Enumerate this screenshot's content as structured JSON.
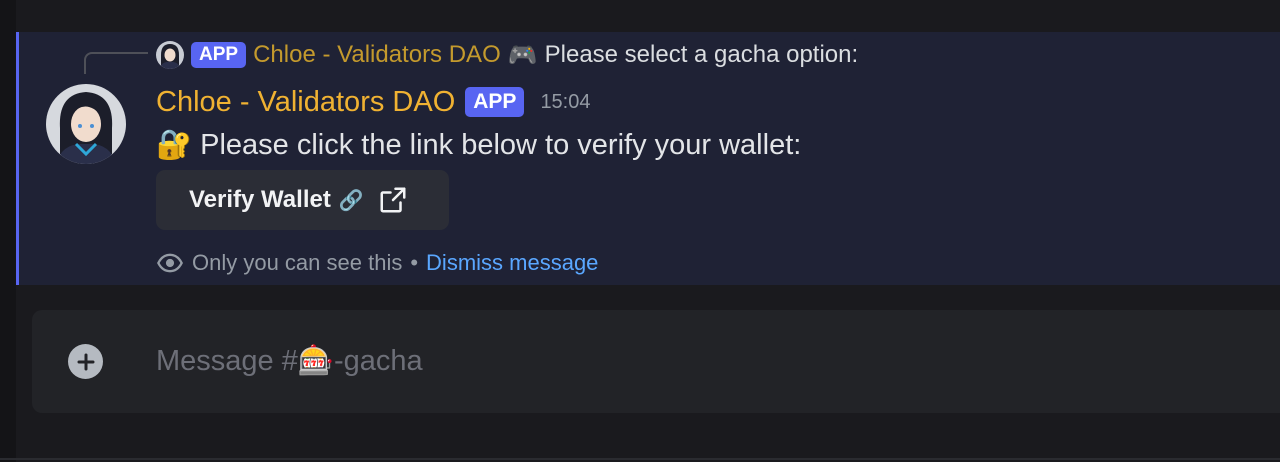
{
  "reply": {
    "badge": "APP",
    "author": "Chloe - Validators DAO",
    "emoji": "🎮",
    "text": "Please select a gacha option:"
  },
  "message": {
    "author": "Chloe - Validators DAO",
    "badge": "APP",
    "timestamp": "15:04",
    "emoji": "🔐",
    "text": "Please click the link below to verify your wallet:",
    "button": {
      "label": "Verify Wallet",
      "label_emoji": "🔗"
    },
    "ephemeral": {
      "text": "Only you can see this",
      "separator": "•",
      "dismiss": "Dismiss message"
    }
  },
  "composer": {
    "placeholder_prefix": "Message #",
    "channel_emoji": "🎰",
    "channel_name": "-gacha"
  },
  "colors": {
    "accent": "#5865f2",
    "author": "#f0b232",
    "link": "#5aa7ff"
  }
}
